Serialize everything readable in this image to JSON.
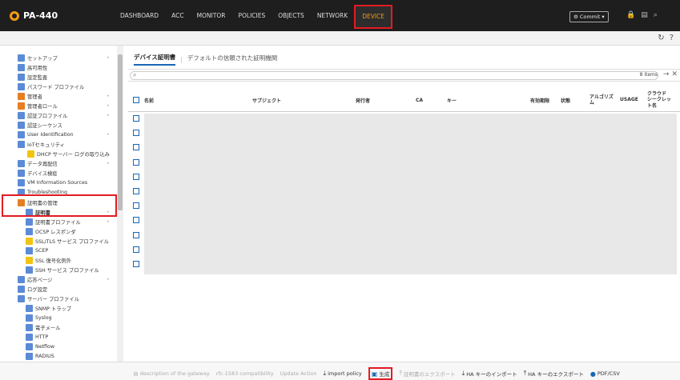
{
  "app": {
    "title": "PA-440"
  },
  "nav": {
    "items": [
      "DASHBOARD",
      "ACC",
      "MONITOR",
      "POLICIES",
      "OBJECTS",
      "NETWORK",
      "DEVICE"
    ],
    "active": "DEVICE"
  },
  "header": {
    "commit_label": "Commit",
    "icons": [
      "lock-icon",
      "config-icon",
      "search-icon"
    ]
  },
  "subbar": {
    "icons": [
      "refresh-icon",
      "help-icon"
    ]
  },
  "sidebar": {
    "items": [
      {
        "label": "セットアップ",
        "dot": true
      },
      {
        "label": "高可用性",
        "dot": false
      },
      {
        "label": "設定監査",
        "dot": false
      },
      {
        "label": "パスワード プロファイル",
        "dot": false
      },
      {
        "label": "管理者",
        "dot": true
      },
      {
        "label": "管理者ロール",
        "dot": true
      },
      {
        "label": "認証プロファイル",
        "dot": true
      },
      {
        "label": "認証シーケンス",
        "dot": false
      },
      {
        "label": "User Identification",
        "dot": true
      },
      {
        "label": "IoTセキュリティ",
        "dot": false
      },
      {
        "label": "DHCP サーバー ログの取り込み",
        "dot": false
      },
      {
        "label": "データ再配信",
        "dot": true
      },
      {
        "label": "デバイス検疫",
        "dot": false
      },
      {
        "label": "VM Information Sources",
        "dot": false
      },
      {
        "label": "Troubleshooting",
        "dot": false
      },
      {
        "label": "証明書の管理",
        "dot": false
      },
      {
        "label": "証明書",
        "dot": true
      },
      {
        "label": "証明書プロファイル",
        "dot": true
      },
      {
        "label": "OCSP レスポンダ",
        "dot": false
      },
      {
        "label": "SSL/TLS サービス プロファイル",
        "dot": false
      },
      {
        "label": "SCEP",
        "dot": false
      },
      {
        "label": "SSL 復号化例外",
        "dot": false
      },
      {
        "label": "SSH サービス プロファイル",
        "dot": false
      },
      {
        "label": "応答ページ",
        "dot": true
      },
      {
        "label": "ログ設定",
        "dot": false
      },
      {
        "label": "サーバー プロファイル",
        "dot": false
      },
      {
        "label": "SNMP トラップ",
        "dot": false
      },
      {
        "label": "Syslog",
        "dot": false
      },
      {
        "label": "電子メール",
        "dot": false
      },
      {
        "label": "HTTP",
        "dot": false
      },
      {
        "label": "Netflow",
        "dot": false
      },
      {
        "label": "RADIUS",
        "dot": false
      }
    ]
  },
  "main": {
    "tabs": [
      "デバイス証明書",
      "デフォルトの信頼された証明機関"
    ],
    "active_tab": "デバイス証明書",
    "search": {
      "placeholder": "",
      "items_count": "8 items"
    },
    "table": {
      "columns": [
        "名前",
        "サブジェクト",
        "発行者",
        "CA",
        "キー",
        "有効期限",
        "状態",
        "アルゴリズム",
        "USAGE",
        "クラウド シークレット名"
      ],
      "row_count": 11
    }
  },
  "actions": [
    {
      "label": "description of the gateway",
      "enabled": false,
      "icon": "circle-minus-icon"
    },
    {
      "label": "rfc-1583 compatibility",
      "enabled": false,
      "icon": ""
    },
    {
      "label": "Update Action",
      "enabled": false,
      "icon": ""
    },
    {
      "label": "import policy",
      "enabled": true,
      "icon": "import-icon"
    },
    {
      "label": "生成",
      "enabled": true,
      "icon": "generate-icon",
      "highlighted": true
    },
    {
      "label": "証明書のエクスポート",
      "enabled": false,
      "icon": "export-icon"
    },
    {
      "label": "HA キーのインポート",
      "enabled": true,
      "icon": "import-icon"
    },
    {
      "label": "HA キーのエクスポート",
      "enabled": true,
      "icon": "export-icon"
    },
    {
      "label": "PDF/CSV",
      "enabled": true,
      "icon": "pdf-icon"
    }
  ],
  "colors": {
    "accent": "#f39c12",
    "highlight": "#e31b23",
    "link": "#1a66b5"
  }
}
